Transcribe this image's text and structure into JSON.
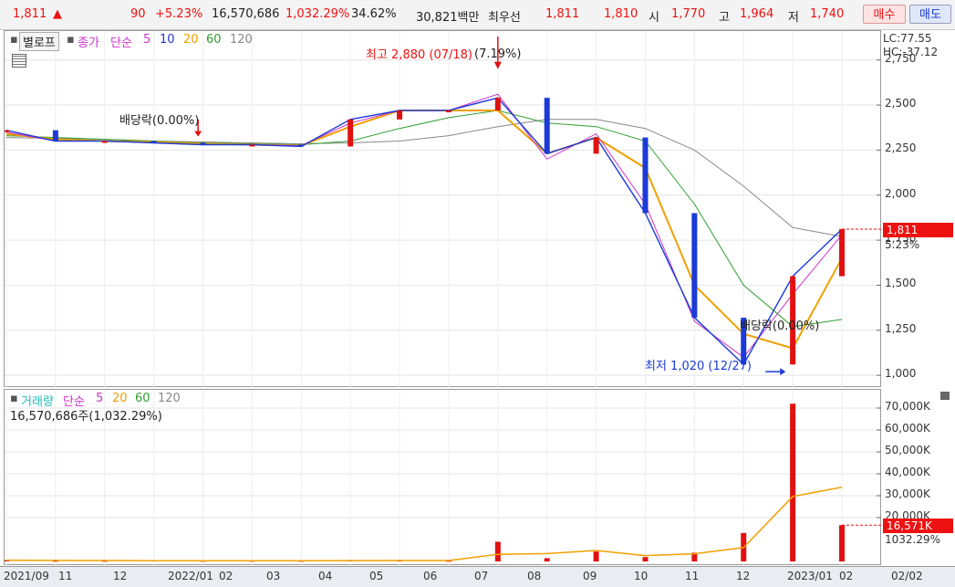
{
  "quote": {
    "price": "1,811",
    "arrow": "▲",
    "change": "90",
    "change_pct": "+5.23%",
    "volume": "16,570,686",
    "volume_ratio": "1,032.29%",
    "turnover": "34.62%",
    "amount": "30,821백만",
    "best_label": "최우선",
    "ask": "1,811",
    "bid": "1,810",
    "open_label": "시",
    "open": "1,770",
    "high_label": "고",
    "high": "1,964",
    "low_label": "저",
    "low": "1,740",
    "buy_button": "매수",
    "sell_button": "매도"
  },
  "price_panel": {
    "mode_button": "별로프",
    "legend": {
      "close": "종가",
      "simple": "단순",
      "ma5": "5",
      "ma10": "10",
      "ma20": "20",
      "ma60": "60",
      "ma120": "120"
    },
    "lc": "LC:77.55",
    "hc": "HC:-37.12",
    "current_price_chip": "1,811",
    "current_change_chip": "5.23%",
    "annotations": {
      "div1": "배당락(0.00%)",
      "high": "최고 2,880 (07/18)",
      "high_pct": "(7.19%)",
      "div2": "배당락(0.00%)",
      "low": "최저 1,020 (12/27)"
    },
    "ticks": [
      "2,750",
      "2,500",
      "2,250",
      "2,000",
      "1,750",
      "1,500",
      "1,250",
      "1,000"
    ]
  },
  "volume_panel": {
    "legend": {
      "title": "거래량",
      "simple": "단순",
      "ma5": "5",
      "ma20": "20",
      "ma60": "60",
      "ma120": "120"
    },
    "summary": "16,570,686주(1,032.29%)",
    "current_volume_chip": "16,571K",
    "current_ratio_chip": "1032.29%",
    "ticks": [
      "70,000K",
      "60,000K",
      "50,000K",
      "40,000K",
      "30,000K",
      "20,000K"
    ]
  },
  "date_axis": [
    "2021/09",
    "11",
    "12",
    "2022/01",
    "02",
    "03",
    "04",
    "05",
    "06",
    "07",
    "08",
    "09",
    "10",
    "11",
    "12",
    "2023/01",
    "02",
    "02/02"
  ],
  "colors": {
    "up": "#e11111",
    "down": "#1b3ad8",
    "ma5": "#cc33cc",
    "ma10": "#2233cc",
    "ma20": "#f0a000",
    "ma60": "#2e9e2e",
    "ma120": "#888888"
  },
  "chart_data": {
    "type": "line",
    "title": "",
    "xlabel": "",
    "ylabel": "",
    "ylim": [
      960,
      2860
    ],
    "x": [
      "2021/09",
      "2021/10",
      "2021/11",
      "2021/12",
      "2022/01",
      "2022/02",
      "2022/03",
      "2022/04",
      "2022/05",
      "2022/06",
      "2022/07",
      "2022/08",
      "2022/09",
      "2022/10",
      "2022/11",
      "2022/12",
      "2023/01",
      "2023/02"
    ],
    "series": [
      {
        "name": "종가",
        "values": [
          2360,
          2300,
          2300,
          2290,
          2280,
          2280,
          2270,
          2420,
          2470,
          2470,
          2540,
          2230,
          2320,
          1900,
          1320,
          1060,
          1550,
          1811
        ]
      },
      {
        "name": "5",
        "values": [
          2350,
          2300,
          2300,
          2290,
          2280,
          2280,
          2275,
          2400,
          2470,
          2470,
          2560,
          2200,
          2340,
          1950,
          1300,
          1100,
          1450,
          1780
        ]
      },
      {
        "name": "20",
        "values": [
          2340,
          2310,
          2300,
          2295,
          2285,
          2280,
          2275,
          2380,
          2470,
          2470,
          2470,
          2230,
          2320,
          2150,
          1500,
          1230,
          1150,
          1650
        ]
      },
      {
        "name": "60",
        "values": [
          2330,
          2320,
          2310,
          2300,
          2290,
          2285,
          2280,
          2300,
          2370,
          2430,
          2470,
          2400,
          2380,
          2300,
          1950,
          1500,
          1270,
          1310
        ]
      },
      {
        "name": "120",
        "values": [
          2320,
          2315,
          2310,
          2300,
          2295,
          2290,
          2285,
          2290,
          2300,
          2330,
          2380,
          2420,
          2420,
          2370,
          2250,
          2050,
          1820,
          1770
        ]
      }
    ],
    "volume": {
      "unit": "K",
      "ylim": [
        0,
        75000
      ],
      "x": [
        "2021/09",
        "2021/10",
        "2021/11",
        "2021/12",
        "2022/01",
        "2022/02",
        "2022/03",
        "2022/04",
        "2022/05",
        "2022/06",
        "2022/07",
        "2022/08",
        "2022/09",
        "2022/10",
        "2022/11",
        "2022/12",
        "2023/01",
        "2023/02"
      ],
      "values": [
        600,
        300,
        300,
        400,
        300,
        300,
        300,
        500,
        400,
        300,
        9000,
        1500,
        4500,
        2000,
        4000,
        13000,
        72000,
        16571
      ]
    },
    "annotations": [
      {
        "label": "최고 2,880 (07/18)",
        "x": "2022/07/18",
        "y": 2880
      },
      {
        "label": "최저 1,020 (12/27)",
        "x": "2022/12/27",
        "y": 1020
      },
      {
        "label": "배당락(0.00%)",
        "x": "2021/12/28"
      },
      {
        "label": "배당락(0.00%)",
        "x": "2022/12/28"
      }
    ]
  }
}
